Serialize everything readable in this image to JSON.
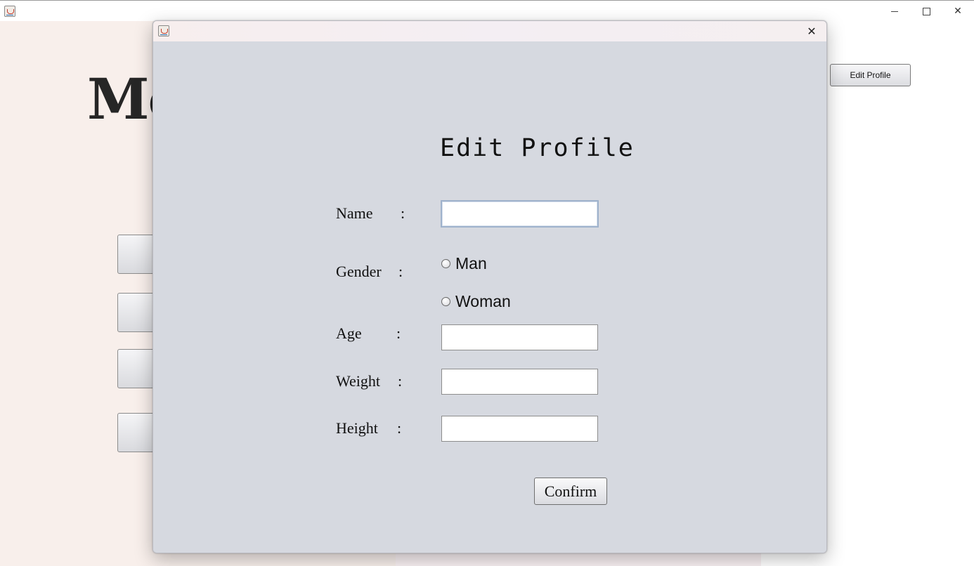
{
  "main_window": {
    "title_icon": "java-icon",
    "controls": {
      "minimize_icon": "minimize-icon",
      "maximize_icon": "maximize-icon",
      "close_glyph": "✕"
    },
    "background_title": "Mo",
    "edit_profile_button": "Edit Profile"
  },
  "dialog": {
    "title_icon": "java-icon",
    "close_glyph": "✕",
    "heading": "Edit Profile",
    "colon": ":",
    "fields": {
      "name": {
        "label": "Name",
        "value": ""
      },
      "gender": {
        "label": "Gender",
        "options": [
          {
            "label": "Man",
            "selected": false
          },
          {
            "label": "Woman",
            "selected": false
          }
        ]
      },
      "age": {
        "label": "Age",
        "value": ""
      },
      "weight": {
        "label": "Weight",
        "value": ""
      },
      "height": {
        "label": "Height",
        "value": ""
      }
    },
    "confirm_button": "Confirm"
  },
  "colors": {
    "dialog_body": "#d6d9e0",
    "background_left": "#f8efeb",
    "background_mid": "#f9f1f3",
    "focused_border": "#9fb2cc"
  }
}
